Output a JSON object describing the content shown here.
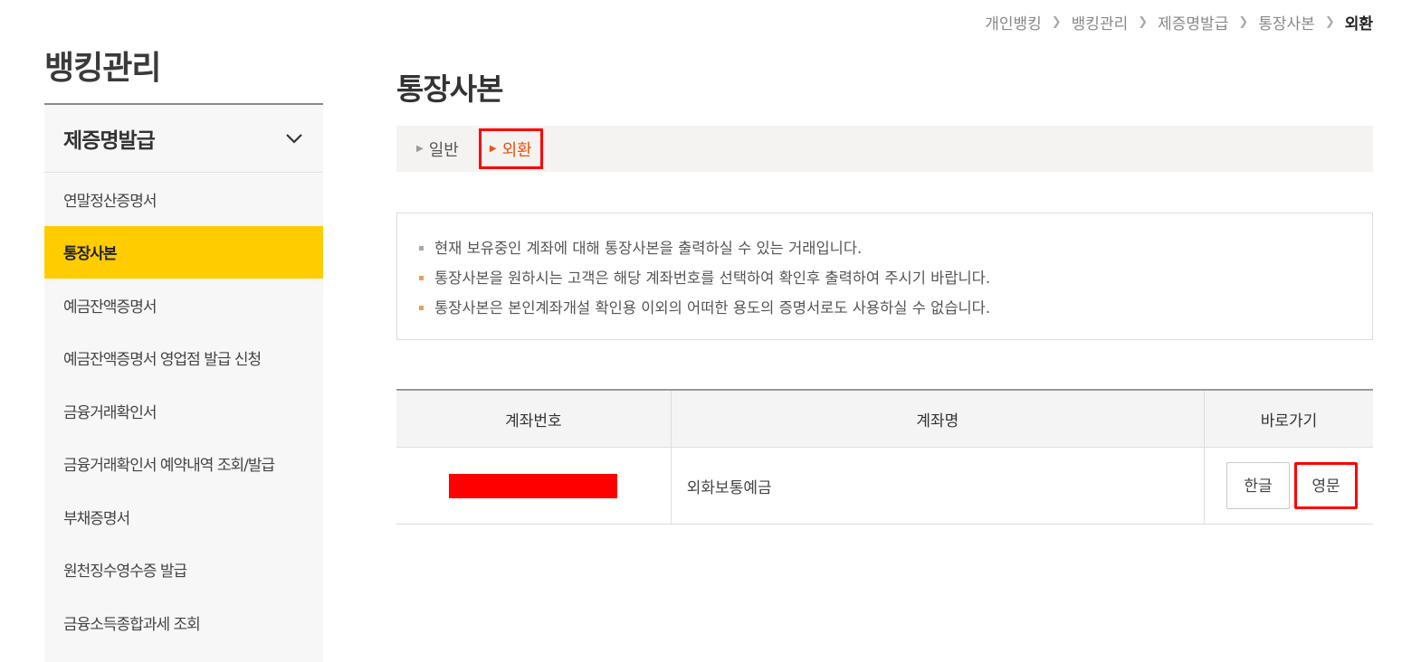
{
  "breadcrumb": [
    "개인뱅킹",
    "뱅킹관리",
    "제증명발급",
    "통장사본",
    "외환"
  ],
  "sidebar": {
    "title": "뱅킹관리",
    "section_label": "제증명발급",
    "section_icon": "chevron-down-icon",
    "items": [
      {
        "label": "연말정산증명서",
        "active": false
      },
      {
        "label": "통장사본",
        "active": true
      },
      {
        "label": "예금잔액증명서",
        "active": false
      },
      {
        "label": "예금잔액증명서 영업점 발급 신청",
        "active": false
      },
      {
        "label": "금융거래확인서",
        "active": false
      },
      {
        "label": "금융거래확인서 예약내역 조회/발급",
        "active": false
      },
      {
        "label": "부채증명서",
        "active": false
      },
      {
        "label": "원천징수영수증 발급",
        "active": false
      },
      {
        "label": "금융소득종합과세 조회",
        "active": false
      }
    ]
  },
  "page": {
    "title": "통장사본",
    "tabs": [
      {
        "label": "일반",
        "active": false
      },
      {
        "label": "외환",
        "active": true
      }
    ],
    "notices": [
      "현재 보유중인 계좌에 대해 통장사본을 출력하실 수 있는 거래입니다.",
      "통장사본을 원하시는 고객은 해당 계좌번호를 선택하여 확인후 출력하여 주시기 바랍니다.",
      "통장사본은 본인계좌개설 확인용 이외의 어떠한 용도의 증명서로도 사용하실 수 없습니다."
    ]
  },
  "table": {
    "headers": [
      "계좌번호",
      "계좌명",
      "바로가기"
    ],
    "rows": [
      {
        "account_name": "외화보통예금",
        "buttons": [
          "한글",
          "영문"
        ]
      }
    ]
  },
  "colors": {
    "accent": "#ffcc00",
    "active_tab": "#e8520b",
    "highlight": "#ff0000"
  }
}
